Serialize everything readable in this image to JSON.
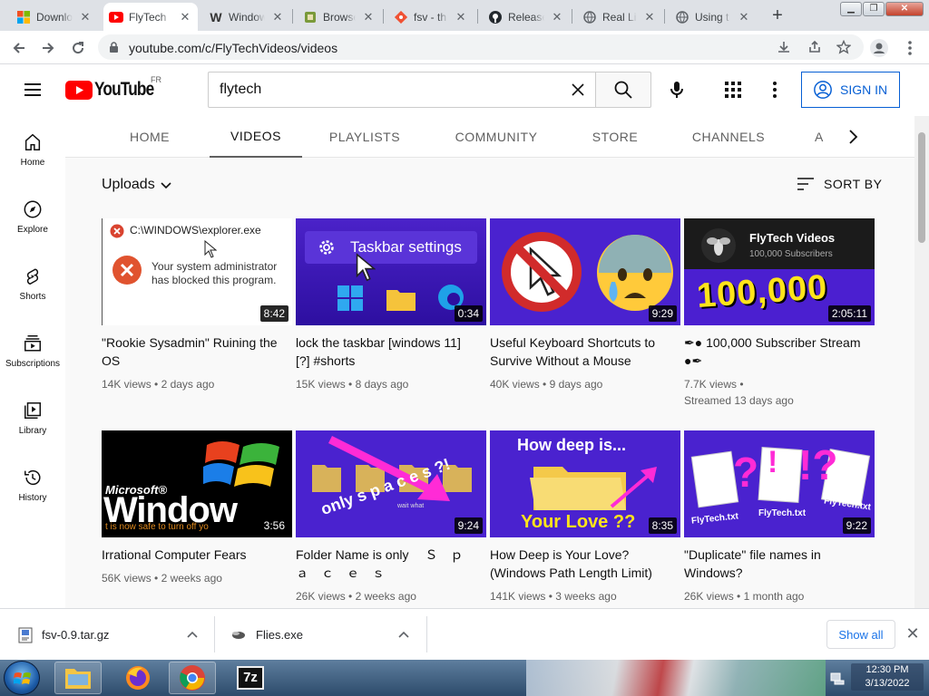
{
  "browser": {
    "tabs": [
      {
        "title": "Download",
        "icon": "windows-logo-icon"
      },
      {
        "title": "FlyTech",
        "icon": "youtube-icon"
      },
      {
        "title": "Windows",
        "icon": "w-icon"
      },
      {
        "title": "Browse",
        "icon": "sourceforge-icon"
      },
      {
        "title": "fsv - th",
        "icon": "git-icon"
      },
      {
        "title": "Release",
        "icon": "github-icon"
      },
      {
        "title": "Real Life",
        "icon": "globe-icon"
      },
      {
        "title": "Using t",
        "icon": "globe-icon"
      }
    ],
    "active_tab": 1,
    "url": "youtube.com/c/FlyTechVideos/videos"
  },
  "youtube": {
    "logo_text": "YouTube",
    "country_code": "FR",
    "search_value": "flytech",
    "signin_label": "SIGN IN"
  },
  "guide": [
    {
      "label": "Home",
      "icon": "home-icon"
    },
    {
      "label": "Explore",
      "icon": "compass-icon"
    },
    {
      "label": "Shorts",
      "icon": "shorts-icon"
    },
    {
      "label": "Subscriptions",
      "icon": "subscriptions-icon"
    },
    {
      "label": "Library",
      "icon": "library-icon"
    },
    {
      "label": "History",
      "icon": "history-icon"
    }
  ],
  "channel_tabs": [
    "HOME",
    "VIDEOS",
    "PLAYLISTS",
    "COMMUNITY",
    "STORE",
    "CHANNELS",
    "A"
  ],
  "active_channel_tab": 1,
  "uploads_label": "Uploads",
  "sort_label": "SORT BY",
  "videos": [
    {
      "title": "\"Rookie Sysadmin\" Ruining the OS",
      "views": "14K views",
      "age": "2 days ago",
      "duration": "8:42",
      "thumb_text": "C:\\WINDOWS\\explorer.exe",
      "thumb_text2": "Your system administrator has blocked this program."
    },
    {
      "title": "lock the taskbar [windows 11] [?] #shorts",
      "views": "15K views",
      "age": "8 days ago",
      "duration": "0:34",
      "thumb_text": "Taskbar settings"
    },
    {
      "title": "Useful Keyboard Shortcuts to Survive Without a Mouse",
      "views": "40K views",
      "age": "9 days ago",
      "duration": "9:29"
    },
    {
      "title": "✒● 100,000 Subscriber Stream ●✒",
      "views": "7.7K views",
      "age": "Streamed 13 days ago",
      "duration": "2:05:11",
      "thumb_text": "FlyTech Videos",
      "thumb_text2": "100,000 Subscribers",
      "thumb_text3": "100,000"
    },
    {
      "title": "Irrational Computer Fears",
      "views": "56K views",
      "age": "2 weeks ago",
      "duration": "3:56",
      "thumb_text": "Microsoft®",
      "thumb_text2": "Window",
      "thumb_text3": "t is now safe to turn off yo"
    },
    {
      "title": "Folder Name is only 　Ｓ　ｐ　ａ　ｃ　ｅ　ｓ",
      "views": "26K views",
      "age": "2 weeks ago",
      "duration": "9:24",
      "thumb_text": "only s p a c e s ?!",
      "thumb_text2": "wait what"
    },
    {
      "title": "How Deep is Your Love? (Windows Path Length Limit)",
      "views": "141K views",
      "age": "3 weeks ago",
      "duration": "8:35",
      "thumb_text": "How deep is...",
      "thumb_text2": "Your Love ??"
    },
    {
      "title": "\"Duplicate\" file names in Windows?",
      "views": "26K views",
      "age": "1 month ago",
      "duration": "9:22",
      "thumb_text": "FlyTech.txt"
    }
  ],
  "downloads": [
    {
      "name": "fsv-0.9.tar.gz",
      "icon": "archive-file-icon"
    },
    {
      "name": "Flies.exe",
      "icon": "exe-file-icon"
    }
  ],
  "show_all_label": "Show all",
  "taskbar": {
    "time": "12:30 PM",
    "date": "3/13/2022",
    "apps": [
      "file-explorer-icon",
      "firefox-icon",
      "chrome-icon",
      "7zip-icon"
    ],
    "sevenzip_label": "7z"
  },
  "colors": {
    "youtube_red": "#ff0000",
    "link_blue": "#065fd4",
    "chrome_tabstrip": "#dee1e6"
  }
}
